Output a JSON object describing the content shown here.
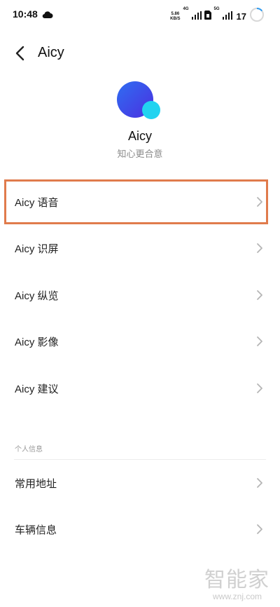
{
  "status_bar": {
    "time": "10:48",
    "net_speed_value": "5.86",
    "net_speed_unit": "KB/S",
    "net_type_1": "4G",
    "net_type_2": "5G",
    "battery": "17",
    "icons": [
      "cloud-icon",
      "signal-icon",
      "sim-icon",
      "signal-icon",
      "battery-ring-icon"
    ]
  },
  "header": {
    "title": "Aicy"
  },
  "profile": {
    "name": "Aicy",
    "subtitle": "知心更合意",
    "logo_colors": {
      "main": "#3a4de8",
      "accent": "#22d3f0"
    }
  },
  "menu_items": [
    {
      "label": "Aicy 语音",
      "highlighted": true
    },
    {
      "label": "Aicy 识屏"
    },
    {
      "label": "Aicy 纵览"
    },
    {
      "label": "Aicy 影像"
    },
    {
      "label": "Aicy 建议"
    }
  ],
  "personal_section": {
    "title": "个人信息",
    "items": [
      {
        "label": "常用地址"
      },
      {
        "label": "车辆信息"
      }
    ]
  },
  "watermark": {
    "logo": "智能家",
    "url": "www.znj.com"
  },
  "colors": {
    "highlight_border": "#e07b4c",
    "chevron": "#b5b5b5"
  }
}
